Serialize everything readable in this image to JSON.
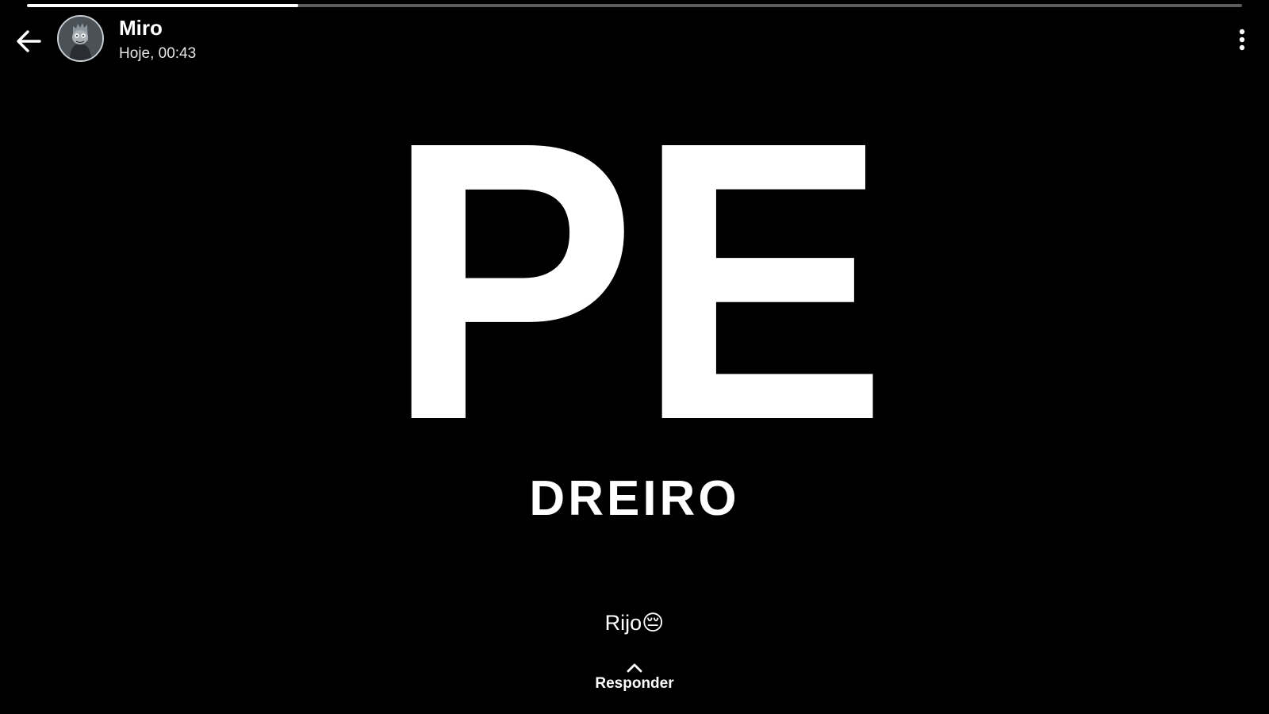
{
  "progress": {
    "fraction": 0.223
  },
  "header": {
    "back_icon": "arrow-left-icon",
    "contact_name": "Miro",
    "timestamp": "Hoje, 00:43",
    "menu_icon": "more-vert-icon"
  },
  "story": {
    "headline": "PE",
    "subline": "DREIRO",
    "caption": "Rijo😔"
  },
  "reply": {
    "icon": "chevron-up-icon",
    "label": "Responder"
  },
  "colors": {
    "background": "#000000",
    "progress_track": "#5c5c5c",
    "progress_fill": "#ffffff",
    "text": "#ffffff"
  }
}
